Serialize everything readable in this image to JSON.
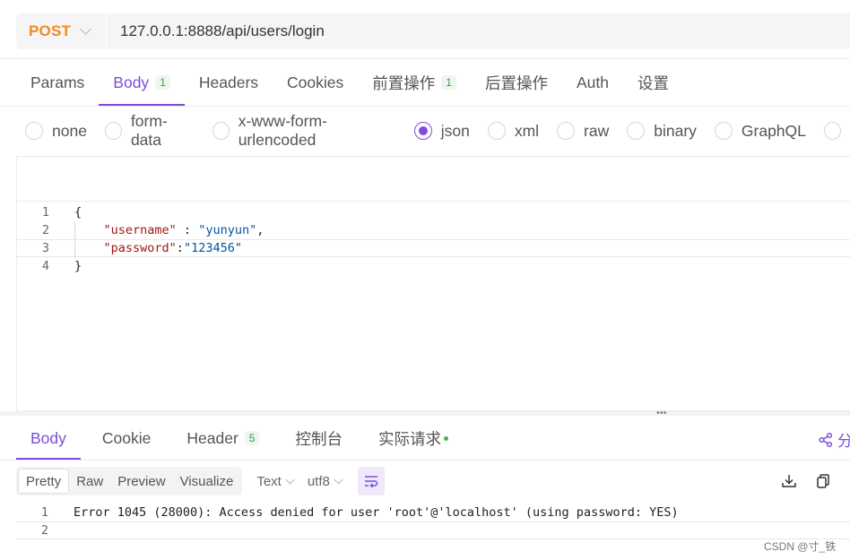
{
  "request": {
    "method": "POST",
    "url": "127.0.0.1:8888/api/users/login"
  },
  "request_tabs": [
    {
      "label": "Params",
      "badge": ""
    },
    {
      "label": "Body",
      "badge": "1"
    },
    {
      "label": "Headers",
      "badge": ""
    },
    {
      "label": "Cookies",
      "badge": ""
    },
    {
      "label": "前置操作",
      "badge": "1"
    },
    {
      "label": "后置操作",
      "badge": ""
    },
    {
      "label": "Auth",
      "badge": ""
    },
    {
      "label": "设置",
      "badge": ""
    }
  ],
  "body_types": [
    "none",
    "form-data",
    "x-www-form-urlencoded",
    "json",
    "xml",
    "raw",
    "binary",
    "GraphQL"
  ],
  "body_type_selected": "json",
  "editor": {
    "line_numbers": [
      "1",
      "2",
      "3",
      "4"
    ],
    "lines": [
      {
        "open": "{"
      },
      {
        "key": "\"username\"",
        "sep": " : ",
        "value": "\"yunyun\"",
        "end": ","
      },
      {
        "key": "\"password\"",
        "sep": ":",
        "value": "\"123456\"",
        "end": ""
      },
      {
        "close": "}"
      }
    ]
  },
  "response_tabs": [
    {
      "label": "Body",
      "badge": ""
    },
    {
      "label": "Cookie",
      "badge": ""
    },
    {
      "label": "Header",
      "badge": "5"
    },
    {
      "label": "控制台",
      "badge": ""
    },
    {
      "label": "实际请求",
      "badge": ""
    }
  ],
  "share_label": "分",
  "response_toolbar": {
    "views": [
      "Pretty",
      "Raw",
      "Preview",
      "Visualize"
    ],
    "format": "Text",
    "encoding": "utf8"
  },
  "response_body": {
    "line_numbers": [
      "1",
      "2"
    ],
    "lines": [
      "Error 1045 (28000): Access denied for user 'root'@'localhost' (using password: YES)",
      ""
    ]
  },
  "watermark": "CSDN @寸_铁",
  "colors": {
    "accent": "#7c4ddb",
    "method": "#f28b1e",
    "badge_green": "#3c9a4e"
  }
}
